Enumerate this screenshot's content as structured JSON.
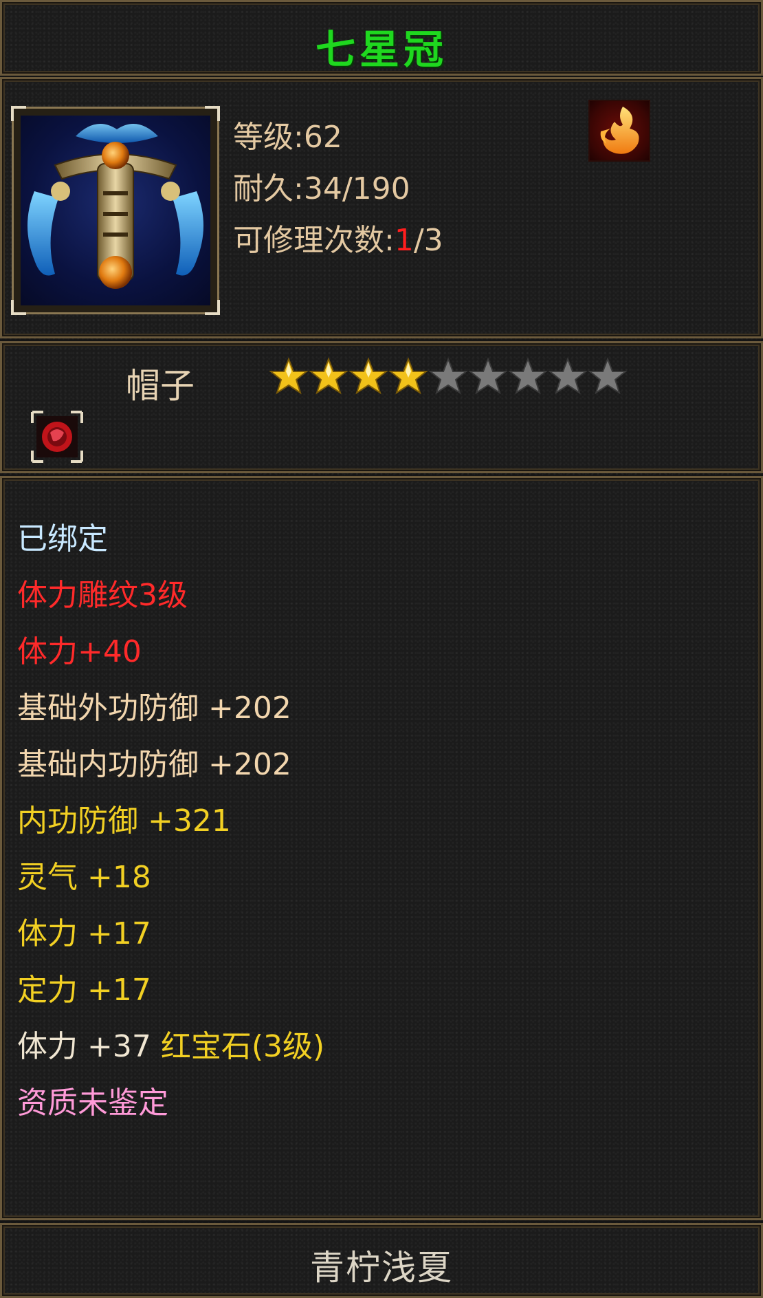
{
  "item": {
    "name": "七星冠",
    "level_label": "等级",
    "level_value": "62",
    "durability_label": "耐久",
    "durability_value": "34/190",
    "repair_label": "可修理次数",
    "repair_used": "1",
    "repair_total": "/3",
    "type": "帽子",
    "stars": {
      "filled": 4,
      "total": 9
    },
    "icon": "crown-item-icon",
    "badge_icon": "fire-element-icon",
    "socket_icon": "red-gem-socket-icon"
  },
  "attributes": [
    {
      "text": "已绑定",
      "color": "#c8e8ff"
    },
    {
      "text": "体力雕纹3级",
      "color": "#ff2a2a"
    },
    {
      "text": "体力+40",
      "color": "#ff2a2a"
    },
    {
      "text": "基础外功防御 +202",
      "color": "#f2d6ae"
    },
    {
      "text": "基础内功防御 +202",
      "color": "#f2d6ae"
    },
    {
      "text": "内功防御 +321",
      "color": "#f2d023"
    },
    {
      "text": "灵气 +18",
      "color": "#f2d023"
    },
    {
      "text": "体力 +17",
      "color": "#f2d023"
    },
    {
      "text": "定力 +17",
      "color": "#f2d023"
    },
    {
      "text_a": "体力 +37 ",
      "text_b": "红宝石(3级)",
      "color": "#f0e6d2"
    },
    {
      "text": "资质未鉴定",
      "color": "#ff9ad8"
    }
  ],
  "footer": {
    "owner": "青柠浅夏"
  }
}
